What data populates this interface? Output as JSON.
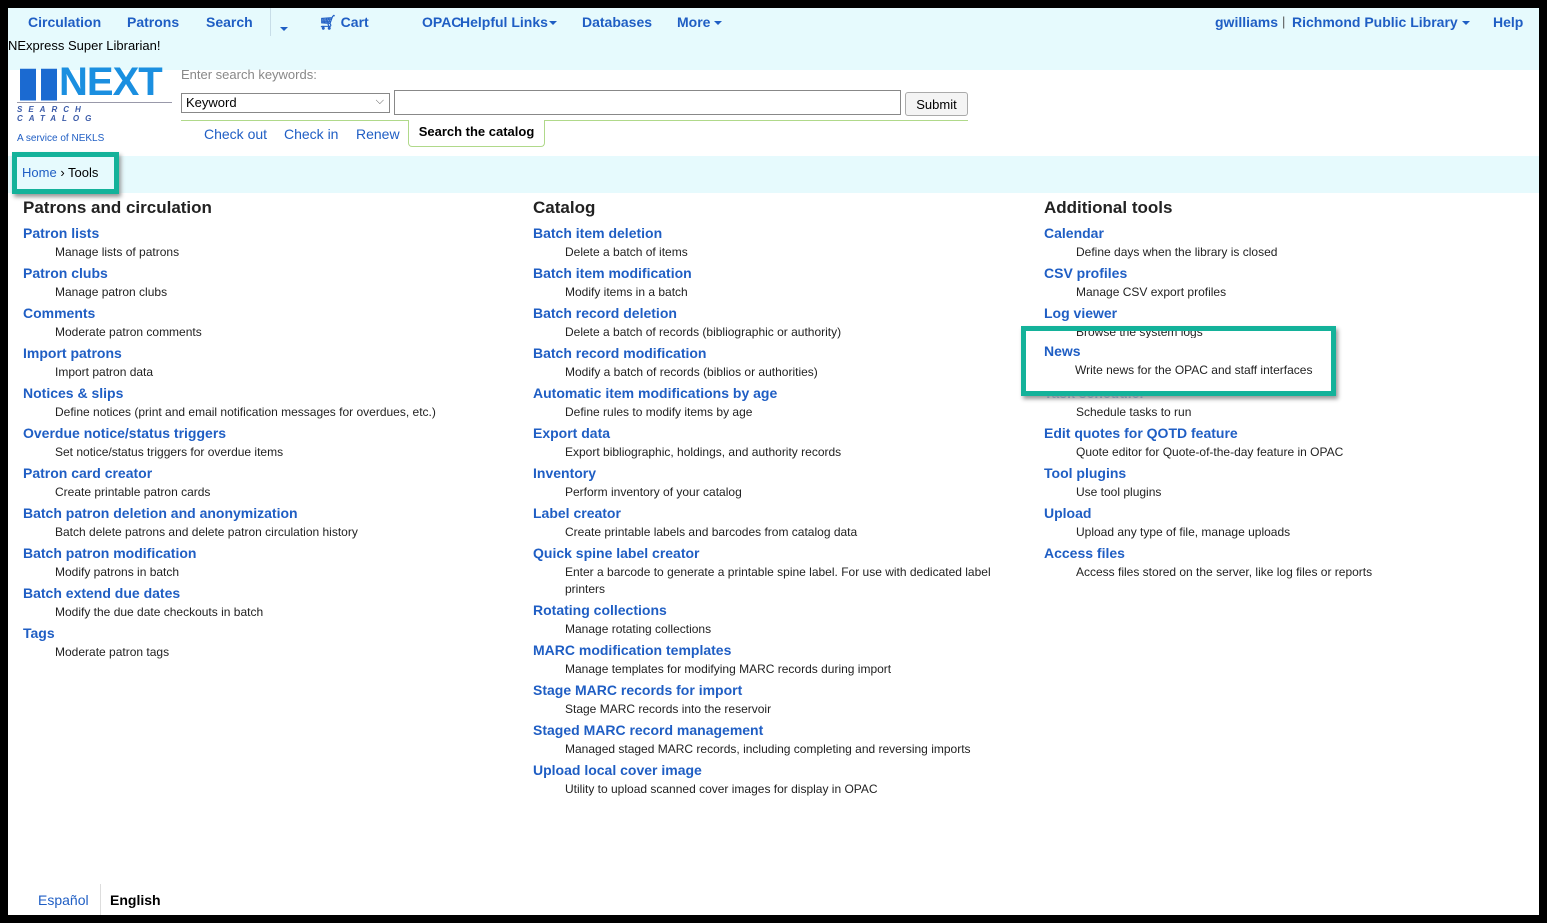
{
  "nav": {
    "items": [
      "Circulation",
      "Patrons",
      "Search",
      "Cart",
      "OPAC",
      "Helpful Links",
      "Databases",
      "More"
    ],
    "user": "gwilliams",
    "library": "Richmond Public Library",
    "help": "Help"
  },
  "greeting": "NExpress Super Librarian!",
  "logo": {
    "text": "NEXT",
    "sub": "SEARCH CATALOG",
    "tagline": "A service of NEKLS"
  },
  "search": {
    "label": "Enter search keywords:",
    "type": "Keyword",
    "value": "",
    "submit": "Submit"
  },
  "tabs": [
    "Check out",
    "Check in",
    "Renew",
    "Search the catalog"
  ],
  "breadcrumb": {
    "home": "Home",
    "sep": "›",
    "current": "Tools"
  },
  "columns": [
    {
      "title": "Patrons and circulation",
      "items": [
        [
          "Patron lists",
          "Manage lists of patrons"
        ],
        [
          "Patron clubs",
          "Manage patron clubs"
        ],
        [
          "Comments",
          "Moderate patron comments"
        ],
        [
          "Import patrons",
          "Import patron data"
        ],
        [
          "Notices & slips",
          "Define notices (print and email notification messages for overdues, etc.)"
        ],
        [
          "Overdue notice/status triggers",
          "Set notice/status triggers for overdue items"
        ],
        [
          "Patron card creator",
          "Create printable patron cards"
        ],
        [
          "Batch patron deletion and anonymization",
          "Batch delete patrons and delete patron circulation history"
        ],
        [
          "Batch patron modification",
          "Modify patrons in batch"
        ],
        [
          "Batch extend due dates",
          "Modify the due date checkouts in batch"
        ],
        [
          "Tags",
          "Moderate patron tags"
        ]
      ]
    },
    {
      "title": "Catalog",
      "items": [
        [
          "Batch item deletion",
          "Delete a batch of items"
        ],
        [
          "Batch item modification",
          "Modify items in a batch"
        ],
        [
          "Batch record deletion",
          "Delete a batch of records (bibliographic or authority)"
        ],
        [
          "Batch record modification",
          "Modify a batch of records (biblios or authorities)"
        ],
        [
          "Automatic item modifications by age",
          "Define rules to modify items by age"
        ],
        [
          "Export data",
          "Export bibliographic, holdings, and authority records"
        ],
        [
          "Inventory",
          "Perform inventory of your catalog"
        ],
        [
          "Label creator",
          "Create printable labels and barcodes from catalog data"
        ],
        [
          "Quick spine label creator",
          "Enter a barcode to generate a printable spine label. For use with dedicated label printers"
        ],
        [
          "Rotating collections",
          "Manage rotating collections"
        ],
        [
          "MARC modification templates",
          "Manage templates for modifying MARC records during import"
        ],
        [
          "Stage MARC records for import",
          "Stage MARC records into the reservoir"
        ],
        [
          "Staged MARC record management",
          "Managed staged MARC records, including completing and reversing imports"
        ],
        [
          "Upload local cover image",
          "Utility to upload scanned cover images for display in OPAC"
        ]
      ]
    },
    {
      "title": "Additional tools",
      "items": [
        [
          "Calendar",
          "Define days when the library is closed"
        ],
        [
          "CSV profiles",
          "Manage CSV export profiles"
        ],
        [
          "Log viewer",
          "Browse the system logs"
        ],
        [
          "News",
          "Write news for the OPAC and staff interfaces"
        ],
        [
          "Task scheduler",
          "Schedule tasks to run"
        ],
        [
          "Edit quotes for QOTD feature",
          "Quote editor for Quote-of-the-day feature in OPAC"
        ],
        [
          "Tool plugins",
          "Use tool plugins"
        ],
        [
          "Upload",
          "Upload any type of file, manage uploads"
        ],
        [
          "Access files",
          "Access files stored on the server, like log files or reports"
        ]
      ]
    }
  ],
  "footer": {
    "languages": [
      "Español",
      "English"
    ]
  },
  "colors": {
    "link": "#1f5ec4",
    "highlight": "#14b29a",
    "band": "#e6fafd"
  }
}
